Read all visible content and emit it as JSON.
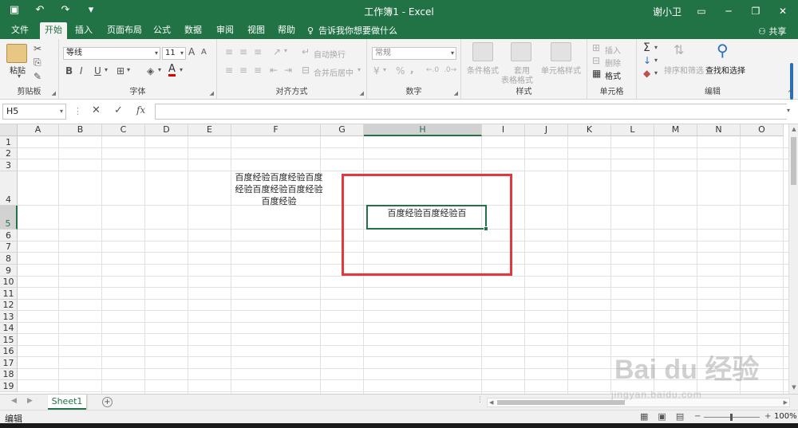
{
  "titlebar": {
    "title": "工作簿1  -  Excel",
    "user": "谢小卫",
    "qat": [
      "save-icon",
      "undo-icon",
      "redo-icon",
      "customize-icon"
    ],
    "window_buttons": [
      "ribbon-display-icon",
      "minimize-icon",
      "restore-icon",
      "close-icon"
    ]
  },
  "tabs": [
    {
      "label": "文件",
      "active": false
    },
    {
      "label": "开始",
      "active": true
    },
    {
      "label": "插入",
      "active": false
    },
    {
      "label": "页面布局",
      "active": false
    },
    {
      "label": "公式",
      "active": false
    },
    {
      "label": "数据",
      "active": false
    },
    {
      "label": "审阅",
      "active": false
    },
    {
      "label": "视图",
      "active": false
    },
    {
      "label": "帮助",
      "active": false
    }
  ],
  "tell_me": "告诉我你想要做什么",
  "share": "共享",
  "ribbon": {
    "clipboard": {
      "label": "剪贴板",
      "paste": "粘贴"
    },
    "font": {
      "label": "字体",
      "font_name": "等线",
      "font_size": "11",
      "bold": "B",
      "italic": "I",
      "underline": "U",
      "grow": "A",
      "shrink": "A",
      "font_color": "A"
    },
    "alignment": {
      "label": "对齐方式",
      "wrap": "自动换行",
      "merge": "合并后居中"
    },
    "number": {
      "label": "数字",
      "format": "常规",
      "percent": "%",
      "comma": ","
    },
    "styles": {
      "label": "样式",
      "conditional": "条件格式",
      "table_line1": "套用",
      "table_line2": "表格格式",
      "cell_styles": "单元格样式"
    },
    "cells": {
      "label": "单元格",
      "insert": "插入",
      "delete": "删除",
      "format": "格式"
    },
    "editing": {
      "label": "编辑",
      "sort": "排序和筛选",
      "find": "查找和选择"
    }
  },
  "formula_bar": {
    "name_box": "H5",
    "fx": "fx",
    "cancel": "✕",
    "enter": "✓",
    "content": ""
  },
  "columns": [
    "A",
    "B",
    "C",
    "D",
    "E",
    "F",
    "G",
    "H",
    "I",
    "J",
    "K",
    "L",
    "M",
    "N",
    "O"
  ],
  "rows": [
    "1",
    "2",
    "3",
    "4",
    "5",
    "6",
    "7",
    "8",
    "9",
    "10",
    "11",
    "12",
    "13",
    "14",
    "15",
    "16",
    "17",
    "18",
    "19"
  ],
  "selected": {
    "column": "H",
    "row": "5",
    "cell": "H5"
  },
  "cells": {
    "F4": "百度经验百度经验百度经验百度经验百度经验百度经验",
    "H5": "百度经验百度经验百"
  },
  "sheets": [
    {
      "name": "Sheet1",
      "active": true
    }
  ],
  "status": {
    "mode": "编辑",
    "zoom": "100%",
    "zoom_level": 1.0
  },
  "watermark": {
    "brand": "Bai du 经验",
    "url": "jingyan.baidu.com"
  },
  "colors": {
    "excel_green": "#217346",
    "highlight_red": "#e03a3e"
  }
}
